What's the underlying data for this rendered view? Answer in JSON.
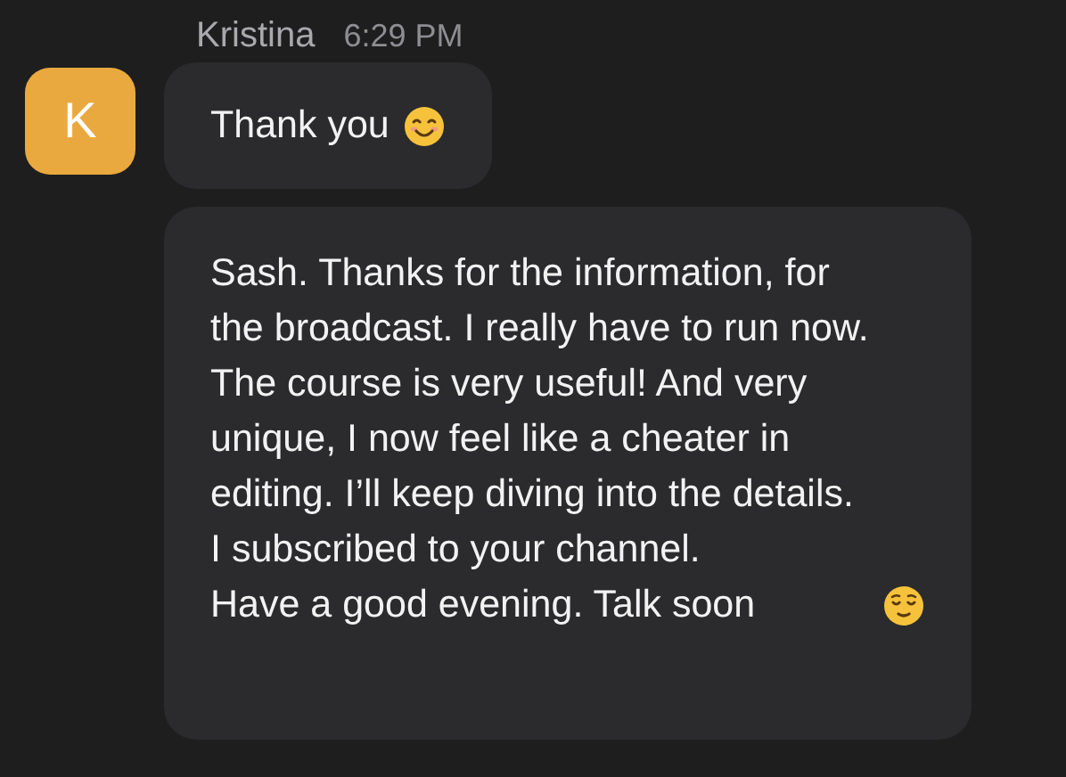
{
  "sender": {
    "name": "Kristina",
    "time": "6:29 PM",
    "initial": "K"
  },
  "messages": [
    {
      "lines": [
        "Thank you"
      ]
    },
    {
      "lines": [
        "Sash. Thanks for the information, for",
        "the broadcast. I really have to run now.",
        "The course is very useful! And very",
        "unique, I now feel like a cheater in",
        "editing. I’ll keep diving into the details.",
        "I subscribed to your channel.",
        "Have a good evening. Talk soon"
      ]
    }
  ]
}
